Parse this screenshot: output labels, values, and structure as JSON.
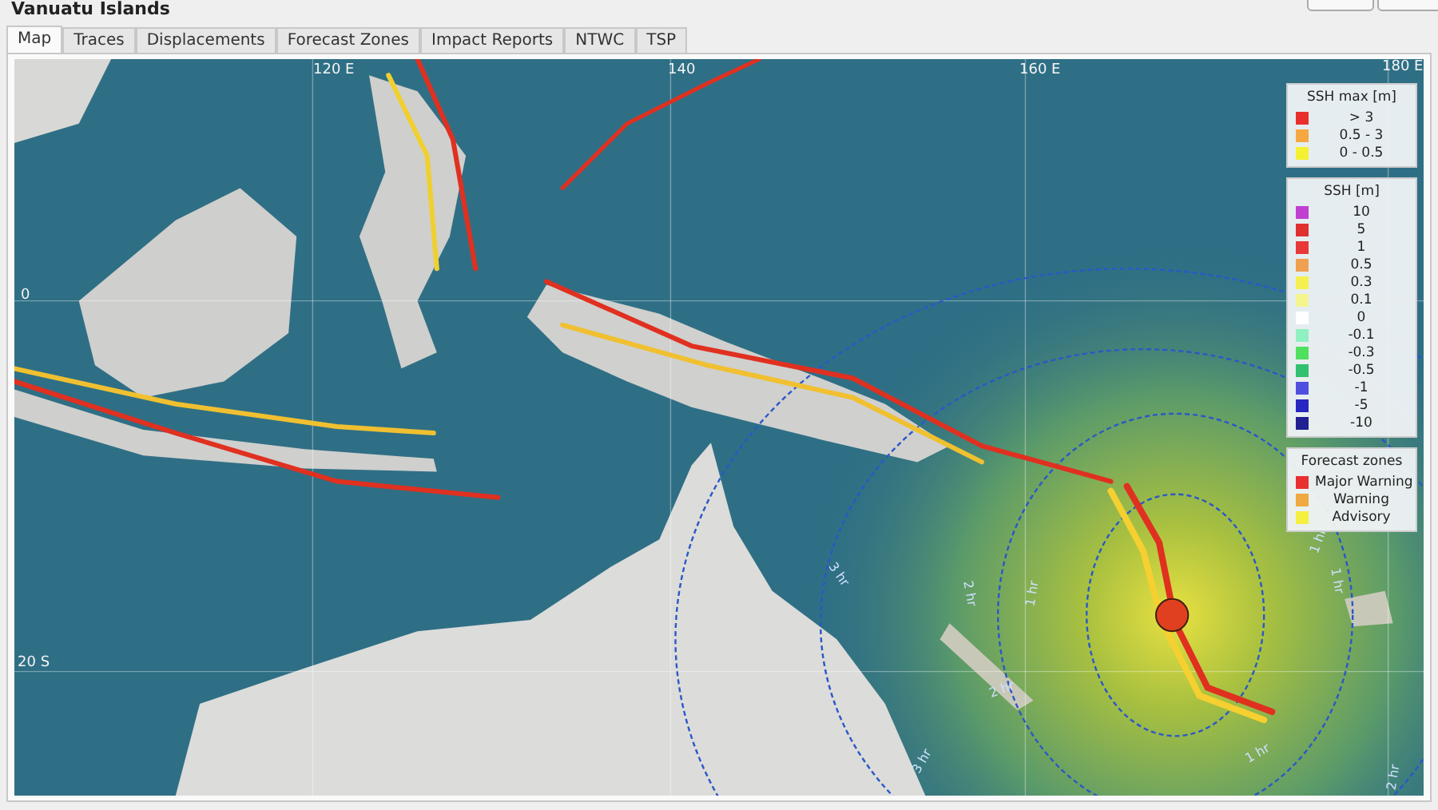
{
  "window": {
    "title": "Vanuatu Islands"
  },
  "tabs": [
    {
      "label": "Map",
      "selected": true
    },
    {
      "label": "Traces",
      "selected": false
    },
    {
      "label": "Displacements",
      "selected": false
    },
    {
      "label": "Forecast Zones",
      "selected": false
    },
    {
      "label": "Impact Reports",
      "selected": false
    },
    {
      "label": "NTWC",
      "selected": false
    },
    {
      "label": "TSP",
      "selected": false
    }
  ],
  "map": {
    "longitude_labels": [
      "120 E",
      "140",
      "160 E",
      "180 E"
    ],
    "latitude_labels": [
      "0",
      "20 S"
    ],
    "travel_time_labels": [
      "3 hr",
      "2 hr",
      "1 hr",
      "1 hr",
      "1 hr",
      "2 hr",
      "1 hr",
      "2 hr",
      "3 hr"
    ],
    "legends": [
      {
        "title": "SSH max [m]",
        "items": [
          {
            "label": "> 3",
            "color": "#e8302a"
          },
          {
            "label": "0.5 - 3",
            "color": "#f5a742"
          },
          {
            "label": "0 - 0.5",
            "color": "#f5f032"
          }
        ]
      },
      {
        "title": "SSH [m]",
        "items": [
          {
            "label": "10",
            "color": "#c040d0"
          },
          {
            "label": "5",
            "color": "#e03030"
          },
          {
            "label": "1",
            "color": "#e83838"
          },
          {
            "label": "0.5",
            "color": "#f0a050"
          },
          {
            "label": "0.3",
            "color": "#f5f050"
          },
          {
            "label": "0.1",
            "color": "#f5f590"
          },
          {
            "label": "0",
            "color": "#ffffff"
          },
          {
            "label": "-0.1",
            "color": "#90f0c0"
          },
          {
            "label": "-0.3",
            "color": "#50e060"
          },
          {
            "label": "-0.5",
            "color": "#30c070"
          },
          {
            "label": "-1",
            "color": "#5050e0"
          },
          {
            "label": "-5",
            "color": "#2828c0"
          },
          {
            "label": "-10",
            "color": "#202090"
          }
        ]
      },
      {
        "title": "Forecast zones",
        "items": [
          {
            "label": "Major Warning",
            "color": "#e83030"
          },
          {
            "label": "Warning",
            "color": "#f0a840"
          },
          {
            "label": "Advisory",
            "color": "#f5f040"
          }
        ]
      }
    ]
  }
}
